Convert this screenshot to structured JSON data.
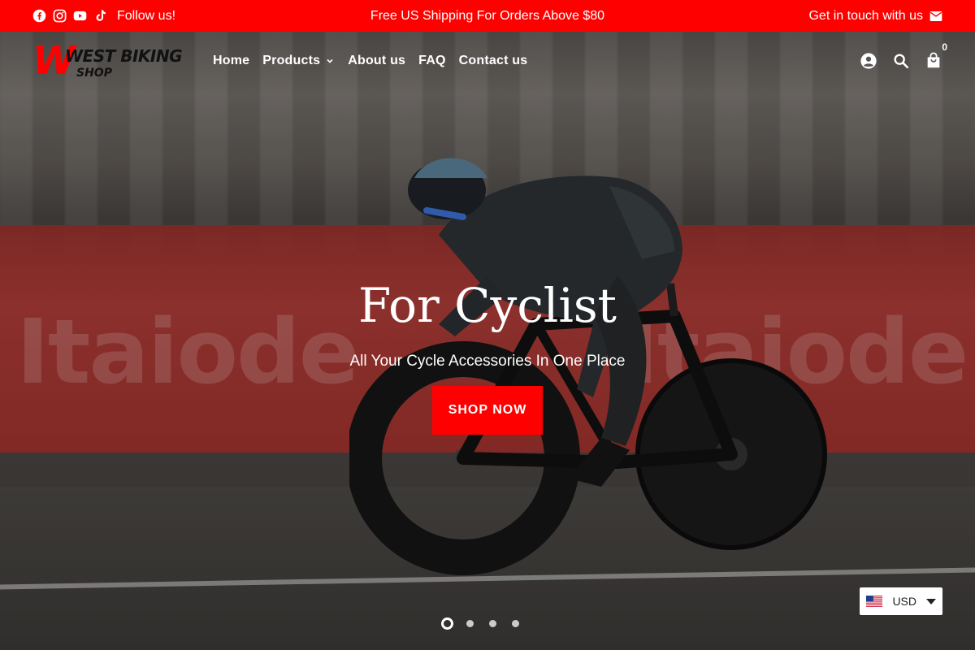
{
  "announcement": {
    "social_icons": [
      "facebook-icon",
      "instagram-icon",
      "youtube-icon",
      "tiktok-icon"
    ],
    "follow_text": "Follow us!",
    "promo_text": "Free US Shipping For Orders Above $80",
    "contact_text": "Get in touch with us",
    "contact_icon": "mail-icon",
    "bg_color": "#ff0000"
  },
  "header": {
    "logo_line1": "WEST BIKING",
    "logo_line2": "SHOP",
    "logo_mark": "W",
    "nav": [
      {
        "label": "Home"
      },
      {
        "label": "Products",
        "has_dropdown": true
      },
      {
        "label": "About us"
      },
      {
        "label": "FAQ"
      },
      {
        "label": "Contact us"
      }
    ],
    "icons": [
      "account-icon",
      "search-icon",
      "cart-icon"
    ],
    "cart_count": "0"
  },
  "hero": {
    "title": "For Cyclist",
    "subtitle": "All Your Cycle Accessories In One Place",
    "button_label": "SHOP NOW",
    "accent_color": "#ff0000",
    "slides_total": 4,
    "slide_active": 1,
    "barrier_text": "Itaiode"
  },
  "currency": {
    "code": "USD",
    "flag": "us-flag-icon"
  }
}
